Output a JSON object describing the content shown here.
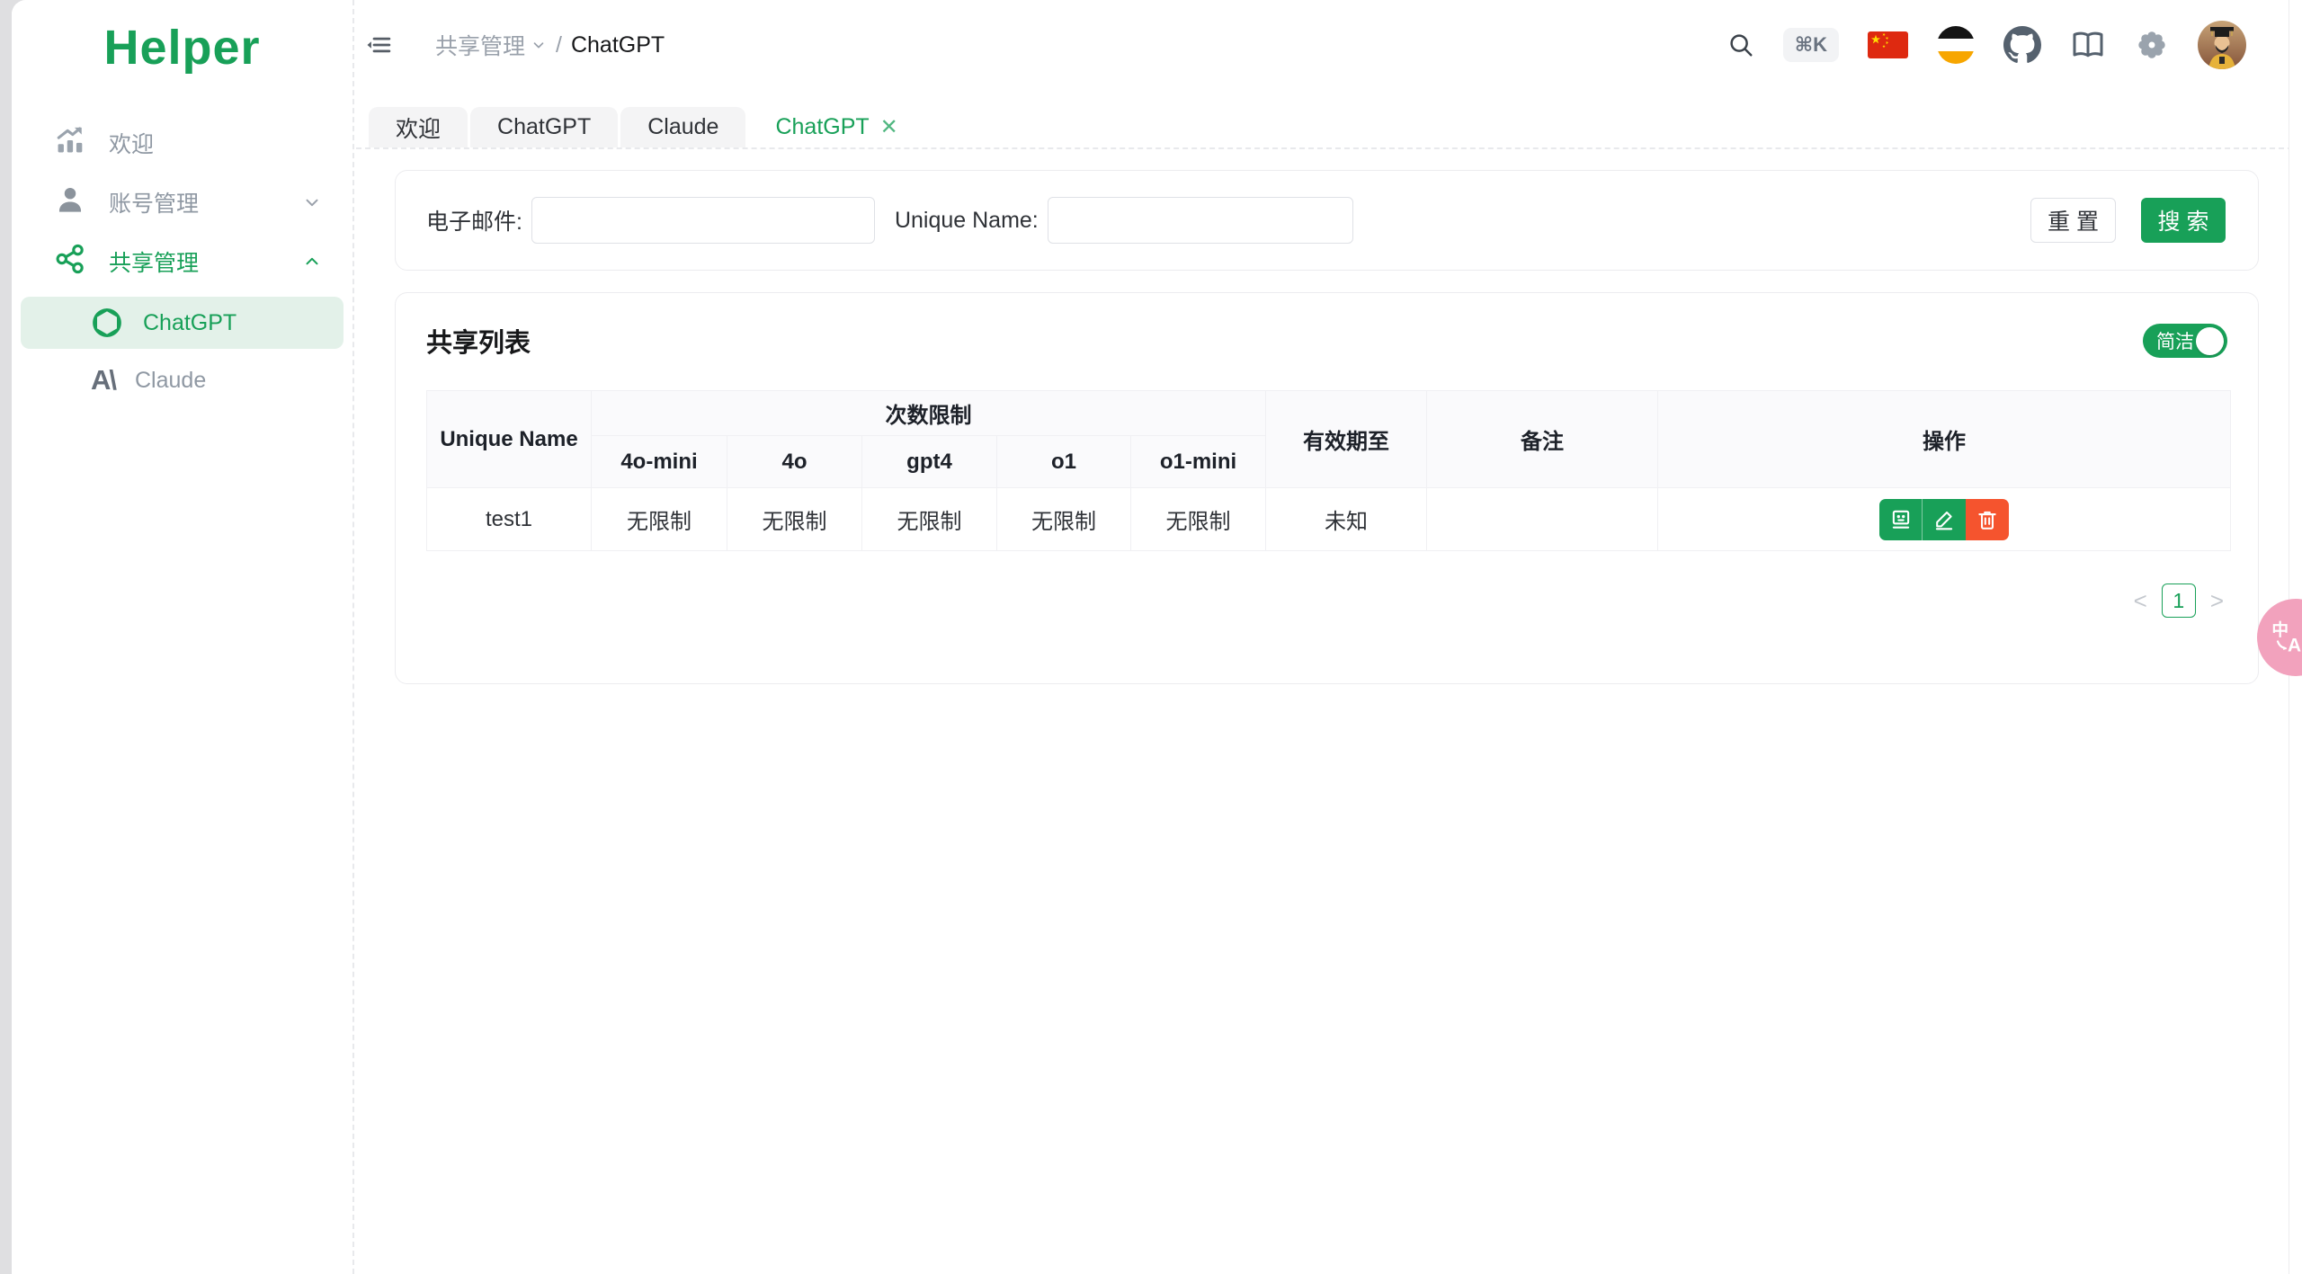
{
  "app": {
    "logo": "Helper"
  },
  "sidebar": {
    "items": [
      {
        "label": "欢迎",
        "icon": "chart-icon"
      },
      {
        "label": "账号管理",
        "icon": "user-icon",
        "chevron": "down"
      },
      {
        "label": "共享管理",
        "icon": "share-icon",
        "chevron": "up",
        "active": true
      }
    ],
    "subitems": [
      {
        "label": "ChatGPT",
        "icon": "openai-icon",
        "active": true
      },
      {
        "label": "Claude",
        "icon": "anthropic-icon",
        "glyph": "A\\"
      }
    ]
  },
  "header": {
    "breadcrumb": {
      "parent": "共享管理",
      "separator": "/",
      "current": "ChatGPT"
    },
    "shortcut": "⌘K",
    "icons": [
      "search-icon",
      "flag-cn-icon",
      "flag-circle-icon",
      "github-icon",
      "book-icon",
      "gear-icon",
      "avatar"
    ]
  },
  "tabs": [
    {
      "label": "欢迎"
    },
    {
      "label": "ChatGPT"
    },
    {
      "label": "Claude"
    },
    {
      "label": "ChatGPT",
      "active": true,
      "close": "✕"
    }
  ],
  "search_form": {
    "email_label": "电子邮件:",
    "email_value": "",
    "unique_name_label": "Unique Name:",
    "unique_name_value": "",
    "reset_label": "重 置",
    "search_label": "搜 索"
  },
  "list_card": {
    "title": "共享列表",
    "toggle_label": "简洁",
    "toggle_on": true,
    "table": {
      "col_unique_name": "Unique Name",
      "col_limit_group": "次数限制",
      "limit_cols": [
        "4o-mini",
        "4o",
        "gpt4",
        "o1",
        "o1-mini"
      ],
      "col_expiry": "有效期至",
      "col_note": "备注",
      "col_actions": "操作",
      "action_icons": [
        "card-info-icon",
        "edit-icon",
        "trash-icon"
      ],
      "rows": [
        {
          "unique_name": "test1",
          "limits": [
            "无限制",
            "无限制",
            "无限制",
            "无限制",
            "无限制"
          ],
          "expiry": "未知",
          "note": ""
        }
      ]
    },
    "pagination": {
      "prev": "<",
      "page": "1",
      "next": ">"
    }
  },
  "colors": {
    "primary": "#18a058",
    "primary_light_bg": "#e3f1e9",
    "danger": "#f5542e",
    "translate_pink": "#f2a2bd"
  }
}
